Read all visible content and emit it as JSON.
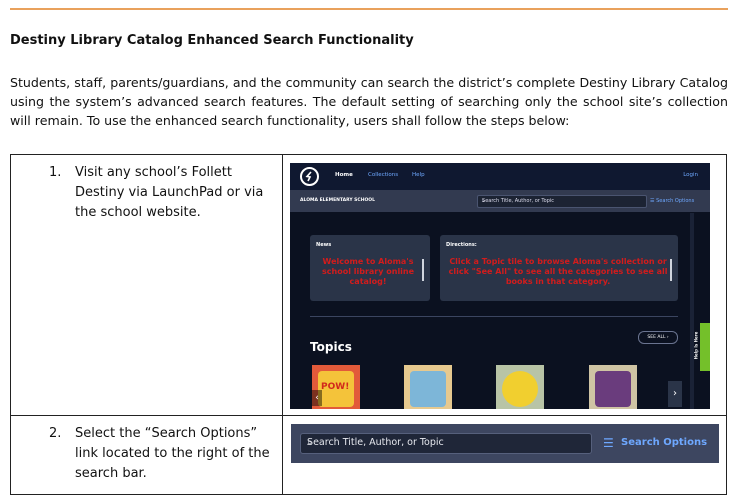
{
  "heading": "Destiny Library Catalog Enhanced Search Functionality",
  "intro": "Students, staff, parents/guardians, and the community can search the district’s complete Destiny Library Catalog using the system’s advanced search features. The default setting of searching only the school site’s collection will remain. To use the enhanced search functionality, users shall follow the steps below:",
  "steps": [
    {
      "number": "1.",
      "text": "Visit any school’s Follett Destiny via LaunchPad or via the school website."
    },
    {
      "number": "2.",
      "text": "Select the “Search Options” link located to the right of the search bar."
    }
  ],
  "destiny": {
    "logo_icon": "follett-logo-icon",
    "nav_home": "Home",
    "nav_collections": "Collections",
    "nav_help": "Help",
    "nav_login": "Login",
    "school_name": "ALOMA ELEMENTARY SCHOOL",
    "search_placeholder": "Search Title, Author, or Topic",
    "search_options": "Search Options",
    "news_label": "News",
    "news_text": "Welcome to Aloma's school library online catalog!",
    "directions_label": "Directions:",
    "directions_text": "Click a Topic tile to browse Aloma's collection or click \"See All\" to see all the categories to see all books in that category.",
    "topics_title": "Topics",
    "see_all": "SEE ALL",
    "thumb_pow": "POW!",
    "help_tab": "Help Is Here",
    "red_text_color": "#d21c1c",
    "link_color": "#6ea8ff"
  },
  "searchbar": {
    "placeholder": "Search Title, Author, or Topic",
    "options_label": "Search Options",
    "search_icon": "search-icon",
    "options_icon": "sliders-icon"
  }
}
